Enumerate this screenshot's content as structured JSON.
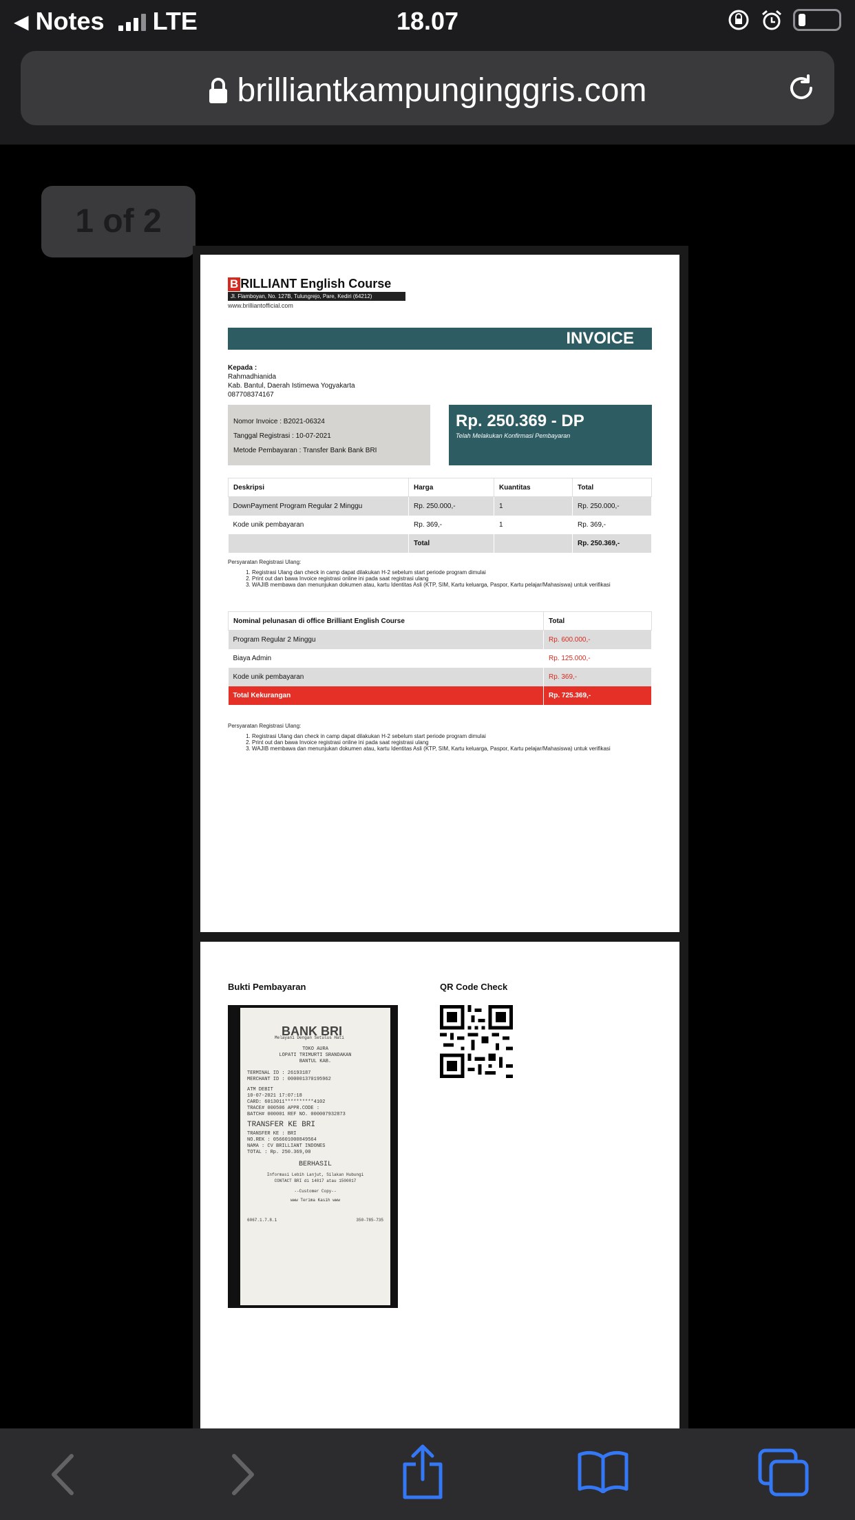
{
  "status": {
    "back_app": "Notes",
    "network": "LTE",
    "time": "18.07"
  },
  "browser": {
    "url": "brilliantkampunginggris.com"
  },
  "viewer": {
    "page_counter": "1 of 2"
  },
  "invoice": {
    "logo_letter": "B",
    "logo_title": "RILLIANT English Course",
    "logo_address": "Jl. Flamboyan, No. 127B, Tulungrejo, Pare, Kediri (64212)",
    "logo_web": "www.brilliantofficial.com",
    "banner": "INVOICE",
    "to_label": "Kepada :",
    "to_name": "Rahmadhianida",
    "to_address": "Kab. Bantul, Daerah Istimewa Yogyakarta",
    "to_phone": "087708374167",
    "invoice_number": "Nomor Invoice : B2021-06324",
    "registration_date": "Tanggal Registrasi : 10-07-2021",
    "payment_method": "Metode Pembayaran : Transfer Bank Bank BRI",
    "amount": "Rp. 250.369 - DP",
    "amount_note": "Telah Melakukan Konfirmasi Pembayaran",
    "table1": {
      "headers": [
        "Deskripsi",
        "Harga",
        "Kuantitas",
        "Total"
      ],
      "rows": [
        [
          "DownPayment Program Regular 2 Minggu",
          "Rp. 250.000,-",
          "1",
          "Rp. 250.000,-"
        ],
        [
          "Kode unik pembayaran",
          "Rp. 369,-",
          "1",
          "Rp. 369,-"
        ]
      ],
      "total_label": "Total",
      "total_value": "Rp. 250.369,-"
    },
    "notes_title": "Persyaratan Registrasi Ulang:",
    "notes": [
      "Registrasi Ulang dan check in camp dapat dilakukan H-2 sebelum start periode program dimulai",
      "Print out dan bawa Invoice registrasi online ini pada saat registrasi ulang",
      "WAJIB membawa dan menunjukan dokumen atau, kartu Identitas Asli (KTP, SIM, Kartu keluarga, Paspor, Kartu pelajar/Mahasiswa) untuk verifikasi"
    ],
    "table2": {
      "headers": [
        "Nominal pelunasan di office Brilliant English Course",
        "Total"
      ],
      "rows": [
        [
          "Program Regular 2 Minggu",
          "Rp. 600.000,-"
        ],
        [
          "Biaya Admin",
          "Rp. 125.000,-"
        ],
        [
          "Kode unik pembayaran",
          "Rp. 369,-"
        ]
      ],
      "total_label": "Total Kekurangan",
      "total_value": "Rp. 725.369,-"
    }
  },
  "page2": {
    "proof_title": "Bukti Pembayaran",
    "qr_title": "QR Code Check",
    "receipt": {
      "bank": "BANK BRI",
      "tagline": "Melayani Dengan Setulus Hati",
      "store": "TOKO AURA",
      "store_addr": "LOPATI TRIMURTI SRANDAKAN",
      "store_city": "BANTUL KAB.",
      "terminal": "TERMINAL ID :        26193187",
      "merchant": "MERCHANT ID :    000001370195962",
      "type": "ATM DEBIT",
      "date": "10-07-2021 17:07:18",
      "card": "CARD: 6013011**********4102",
      "trace": "TRACE# 000506    APPR.CODE :",
      "batch": "BATCH# 000001    REF NO.  000007932873",
      "transfer": "TRANSFER KE BRI",
      "transfer_to": "TRANSFER KE   : BRI",
      "rek": "NO.REK        : 056601000849564",
      "nama": "NAMA          : CV BRILLIANT INDONES",
      "total": "TOTAL         : Rp. 250.369,00",
      "result": "BERHASIL",
      "footer1": "Informasi Lebih Lanjut, Silakan Hubungi",
      "footer2": "CONTACT BRI di 14017 atau 1500017",
      "footer3": "--Customer Copy--",
      "footer4": "www Terima Kasih www",
      "code_left": "6067.1.7.8.1",
      "code_right": "350-785-735"
    }
  },
  "toolbar": {
    "icons": [
      "back-icon",
      "forward-icon",
      "share-icon",
      "bookmarks-icon",
      "tabs-icon"
    ]
  },
  "colors": {
    "teal": "#2d5d62",
    "red": "#e53027",
    "ios_blue": "#3478f6"
  }
}
